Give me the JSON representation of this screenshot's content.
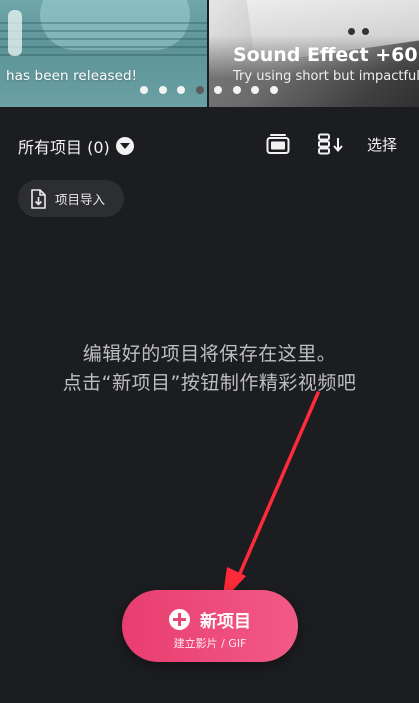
{
  "banner": {
    "slides": [
      {
        "caption": "has been released!"
      },
      {
        "title": "Sound Effect +60",
        "subtitle": "Try using short but impactful"
      }
    ],
    "pager": {
      "count": 8,
      "active_index": 3
    }
  },
  "header": {
    "all_projects_label": "所有项目 (0)",
    "select_label": "选择"
  },
  "import": {
    "label": "项目导入"
  },
  "empty_state": {
    "line1": "编辑好的项目将保存在这里。",
    "line2": "点击“新项目”按钮制作精彩视频吧"
  },
  "new_project": {
    "label": "新项目",
    "sublabel": "建立影片 / GIF"
  },
  "colors": {
    "background": "#1c1d20",
    "accent": "#ea4676",
    "annotation_arrow": "#ff2a3a"
  },
  "icons": [
    "caret-down-icon",
    "view-mode-icon",
    "sort-icon",
    "import-file-icon",
    "plus-icon"
  ]
}
